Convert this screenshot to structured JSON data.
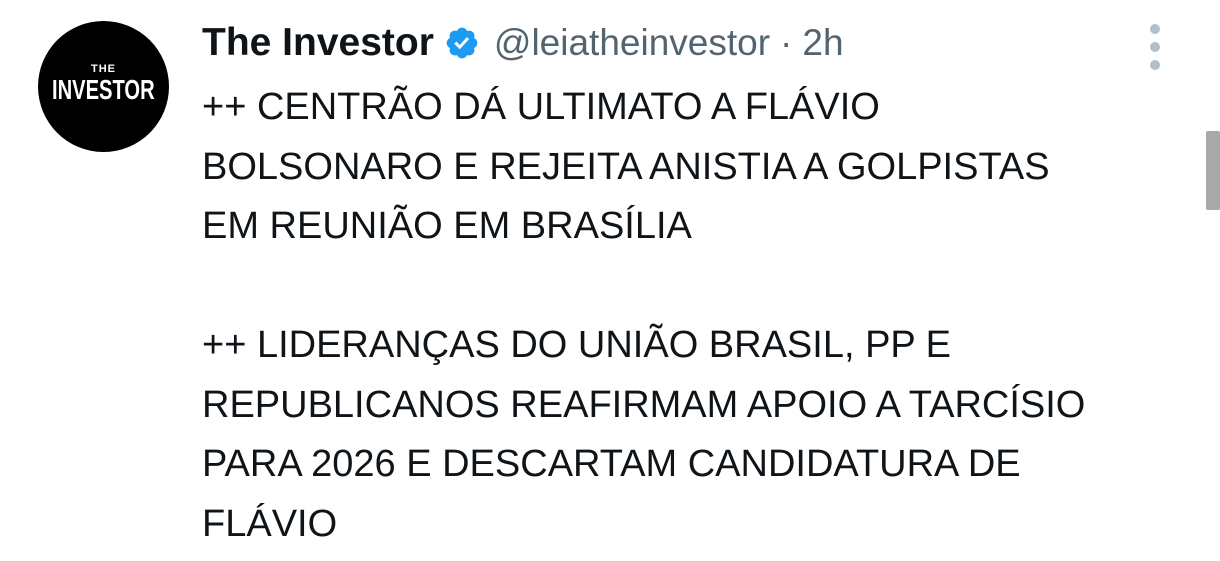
{
  "post": {
    "author": {
      "avatar_text_small": "THE",
      "avatar_text_big": "INVESTOR",
      "display_name": "The Investor",
      "verified_icon": "verified-badge-icon",
      "handle": "@leiatheinvestor",
      "separator": "·",
      "time": "2h"
    },
    "more_icon": "vertical-ellipsis-icon",
    "paragraphs": [
      {
        "lines": [
          "++ CENTRÃO DÁ ULTIMATO A FLÁVIO",
          "BOLSONARO E REJEITA ANISTIA A GOLPISTAS",
          "EM REUNIÃO EM BRASÍLIA"
        ]
      },
      {
        "lines": [
          "++ LIDERANÇAS DO UNIÃO BRASIL, PP E",
          "REPUBLICANOS REAFIRMAM APOIO A TARCÍSIO",
          "PARA 2026 E DESCARTAM CANDIDATURA DE",
          "FLÁVIO"
        ]
      }
    ]
  },
  "colors": {
    "text": "#0f1419",
    "secondary_text": "#536471",
    "verified_blue": "#1d9bf0",
    "avatar_bg": "#000000",
    "more_dots": "#b3bec6",
    "scrollbar": "#a9a9a9"
  }
}
